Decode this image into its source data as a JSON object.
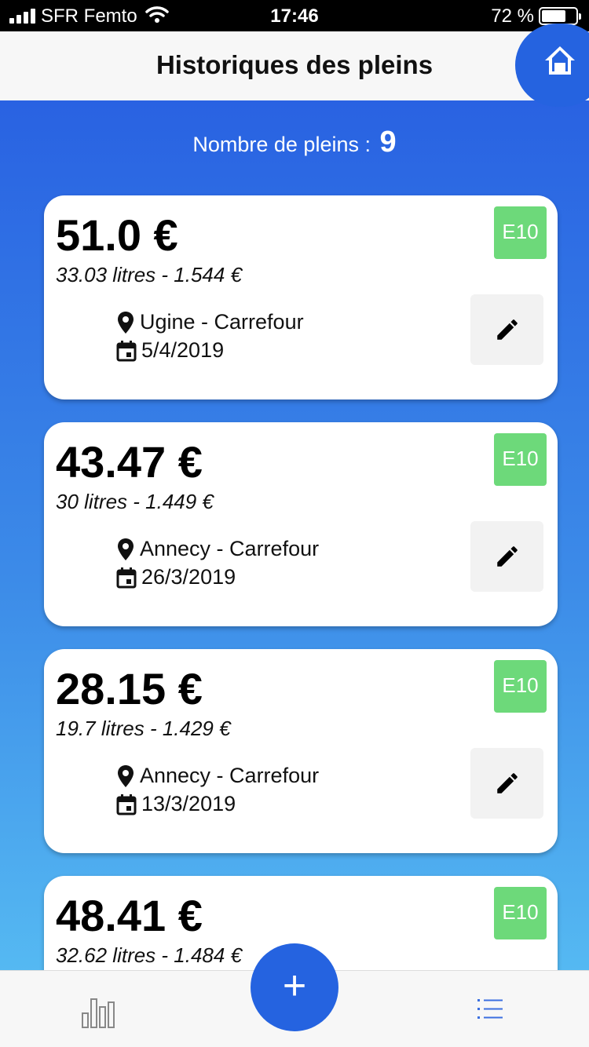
{
  "status_bar": {
    "carrier": "SFR Femto",
    "time": "17:46",
    "battery": "72 %"
  },
  "header": {
    "title": "Historiques des pleins"
  },
  "summary": {
    "label": "Nombre de pleins :",
    "count": "9"
  },
  "entries": [
    {
      "price": "51.0 €",
      "detail": "33.03 litres - 1.544 €",
      "fuel": "E10",
      "location": "Ugine - Carrefour",
      "date": "5/4/2019"
    },
    {
      "price": "43.47 €",
      "detail": "30 litres - 1.449 €",
      "fuel": "E10",
      "location": "Annecy - Carrefour",
      "date": "26/3/2019"
    },
    {
      "price": "28.15 €",
      "detail": "19.7 litres - 1.429 €",
      "fuel": "E10",
      "location": "Annecy - Carrefour",
      "date": "13/3/2019"
    },
    {
      "price": "48.41 €",
      "detail": "32.62 litres - 1.484 €",
      "fuel": "E10",
      "location": "",
      "date": ""
    }
  ],
  "bottom_nav": {
    "add_label": "+",
    "stats_icon": "bar-chart-icon",
    "list_icon": "list-icon"
  },
  "colors": {
    "primary": "#2563e0",
    "fuel_badge": "#6dd97a",
    "gradient_top": "#2962e2",
    "gradient_bottom": "#55b9f2"
  }
}
